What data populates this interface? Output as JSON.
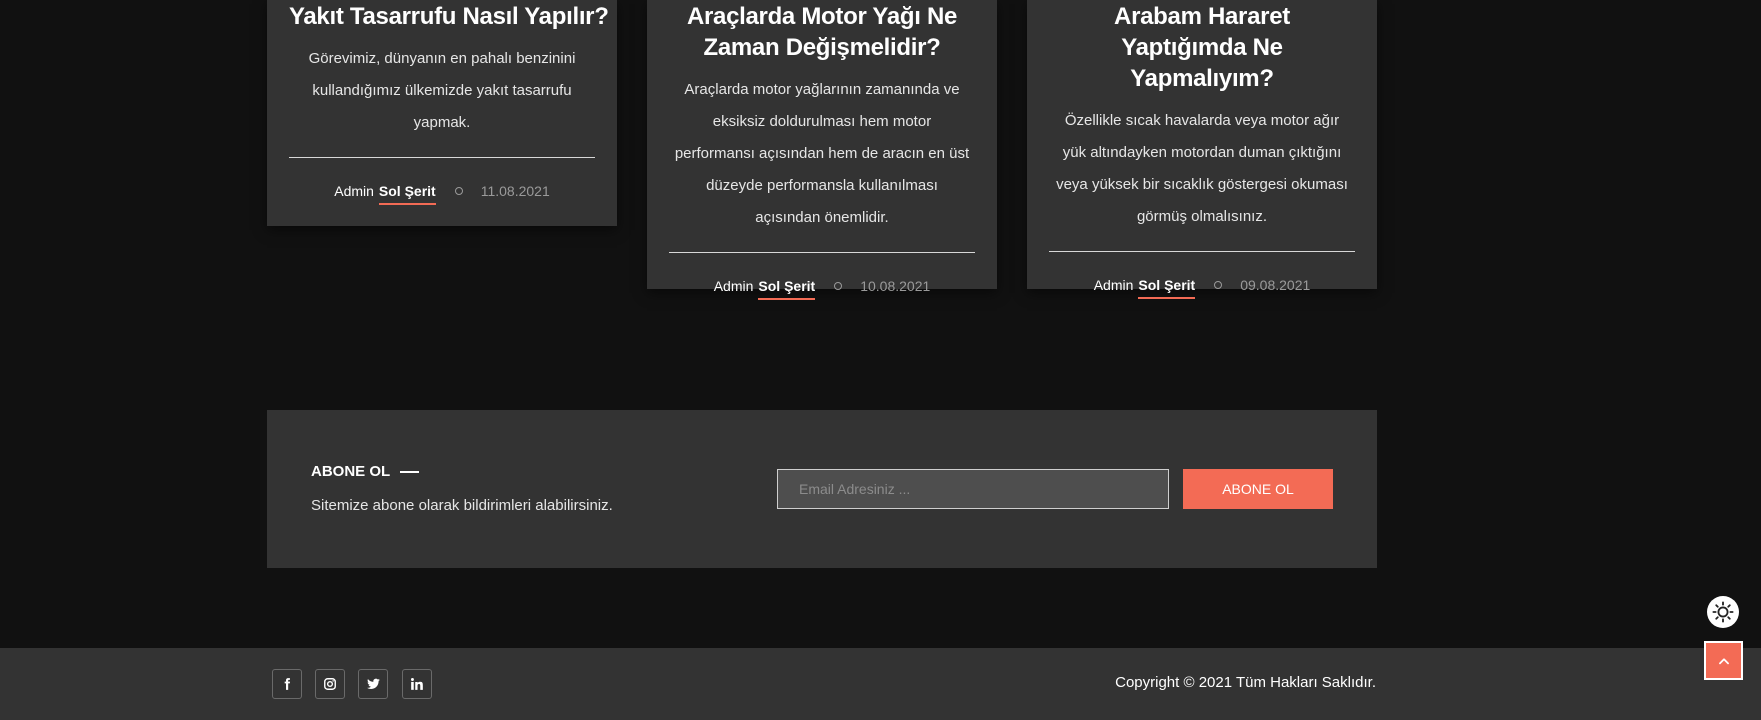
{
  "posts": [
    {
      "title": "Yakıt Tasarrufu Nasıl Yapılır?",
      "excerpt": "Görevimiz, dünyanın en pahalı benzinini kullandığımız ülkemizde yakıt tasarrufu yapmak.",
      "author": "Admin",
      "category": "Sol Şerit",
      "date": "11.08.2021"
    },
    {
      "title": "Araçlarda Motor Yağı Ne Zaman Değişmelidir?",
      "excerpt": "Araçlarda motor yağlarının zamanında ve eksiksiz doldurulması hem motor performansı açısından hem de aracın en üst düzeyde performansla kullanılması açısından önemlidir.",
      "author": "Admin",
      "category": "Sol Şerit",
      "date": "10.08.2021"
    },
    {
      "title": "Arabam Hararet Yaptığımda Ne Yapmalıyım?",
      "excerpt": "Özellikle sıcak havalarda veya motor ağır yük altındayken motordan duman çıktığını veya yüksek bir sıcaklık göstergesi okuması görmüş olmalısınız.",
      "author": "Admin",
      "category": "Sol Şerit",
      "date": "09.08.2021"
    }
  ],
  "newsletter": {
    "heading": "ABONE OL",
    "text": "Sitemize abone olarak bildirimleri alabilirsiniz.",
    "email_placeholder": "Email Adresiniz ...",
    "email_value": "",
    "button_label": "ABONE OL"
  },
  "floating": {
    "theme_toggle_icon": "sun-icon",
    "scroll_top_icon": "chevron-up-icon"
  },
  "footer": {
    "social": [
      {
        "name": "facebook",
        "icon": "facebook-icon"
      },
      {
        "name": "instagram",
        "icon": "instagram-icon"
      },
      {
        "name": "twitter",
        "icon": "twitter-icon"
      },
      {
        "name": "linkedin",
        "icon": "linkedin-icon"
      }
    ],
    "copyright": "Copyright © 2021 Tüm Hakları Saklıdır."
  },
  "colors": {
    "background": "#111111",
    "card": "#333333",
    "accent": "#f36b55",
    "muted": "#9a9a9a"
  }
}
